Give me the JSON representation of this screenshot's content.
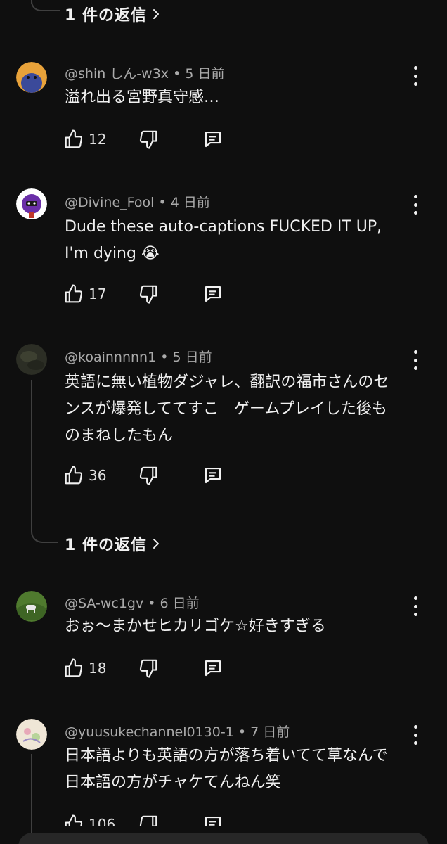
{
  "replies_link_top": {
    "label": "1 件の返信"
  },
  "replies_link_mid": {
    "label": "1 件の返信"
  },
  "comments": [
    {
      "handle": "@shin しん-w3x",
      "age": "5 日前",
      "text": "溢れ出る宮野真守感…",
      "likes": "12",
      "avatar": "blue-cartoon-avatar"
    },
    {
      "handle": "@Divine_Fool",
      "age": "4 日前",
      "text": "Dude these auto-captions FUCKED IT UP, I'm dying 😭",
      "likes": "17",
      "avatar": "purple-character-avatar"
    },
    {
      "handle": "@koainnnnn1",
      "age": "5 日前",
      "text": "英語に無い植物ダジャレ、翻訳の福市さんのセンスが爆発しててすこ　ゲームプレイした後ものまねしたもん",
      "likes": "36",
      "avatar": "dark-photo-avatar"
    },
    {
      "handle": "@SA-wc1gv",
      "age": "6 日前",
      "text": "おぉ～まかせヒカリゴケ☆好きすぎる",
      "likes": "18",
      "avatar": "green-field-avatar"
    },
    {
      "handle": "@yuusukechannel0130-1",
      "age": "7 日前",
      "text": "日本語よりも英語の方が落ち着いてて草なんで日本語の方がチャケてんねん笑",
      "likes": "106",
      "avatar": "illustration-avatar"
    }
  ],
  "colors": {
    "background": "#0f0f0f",
    "text": "#f1f1f1",
    "meta": "#aaaaaa",
    "thread_line": "#3f3f3f"
  }
}
